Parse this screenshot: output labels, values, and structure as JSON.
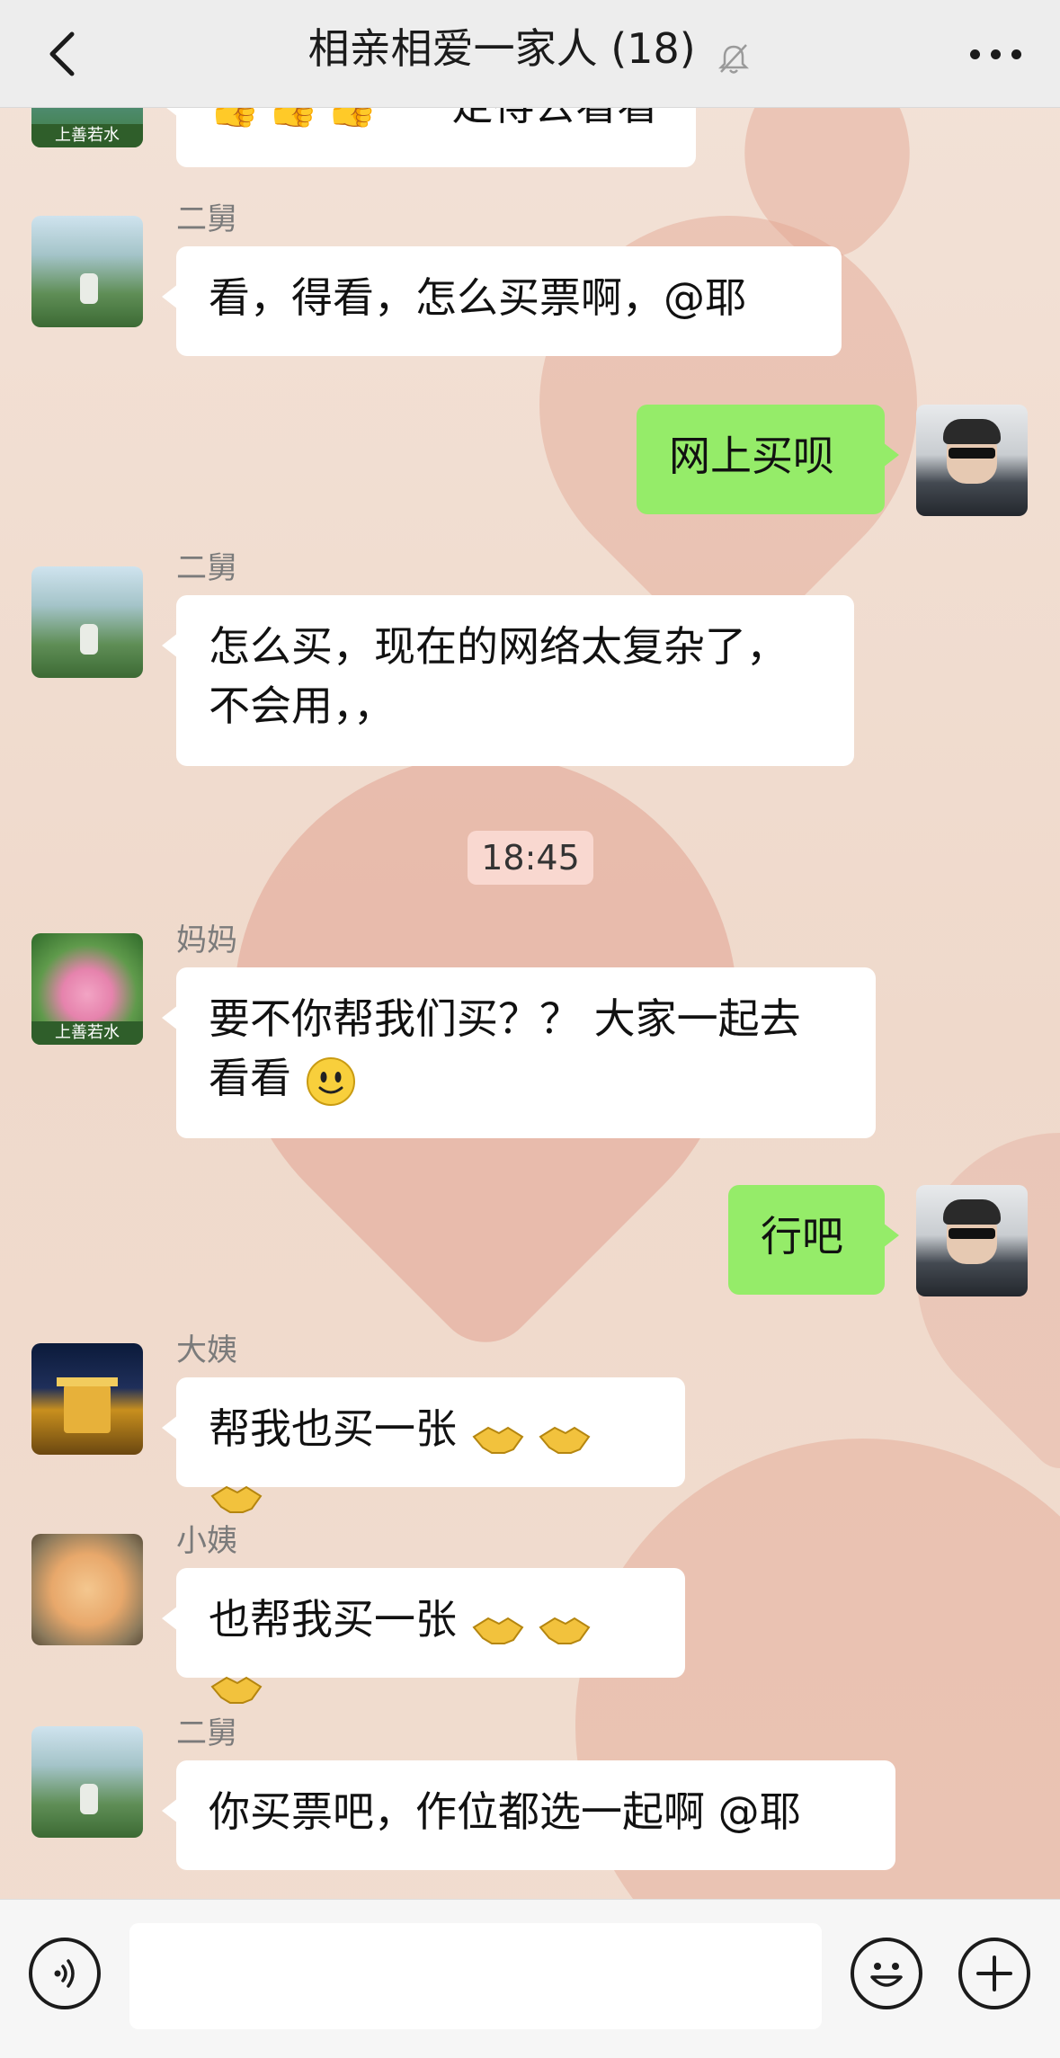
{
  "header": {
    "title": "相亲相爱一家人 (18)"
  },
  "time_separator": "18:45",
  "messages": [
    {
      "id": "m0",
      "side": "left",
      "sender": "",
      "text": "一定得去看看",
      "emoji_prefix": "👍👍👍",
      "avatar": "lotus-avatar",
      "avatar_caption": "上善若水"
    },
    {
      "id": "m1",
      "side": "left",
      "sender": "二舅",
      "text": "看，得看，怎么买票啊，@耶",
      "avatar": "mountain-avatar"
    },
    {
      "id": "m2",
      "side": "right",
      "sender": "",
      "text": "网上买呗",
      "avatar": "me-avatar"
    },
    {
      "id": "m3",
      "side": "left",
      "sender": "二舅",
      "text": "怎么买，现在的网络太复杂了，",
      "text2": "不会用，，",
      "avatar": "mountain-avatar"
    },
    {
      "id": "m4",
      "side": "left",
      "sender": "妈妈",
      "text": "要不你帮我们买？？  大家一起去",
      "text2": "看看",
      "avatar": "lotus-avatar",
      "avatar_caption": "上善若水"
    },
    {
      "id": "m5",
      "side": "right",
      "sender": "",
      "text": "行吧",
      "avatar": "me-avatar"
    },
    {
      "id": "m6",
      "side": "left",
      "sender": "大姨",
      "text": "帮我也买一张",
      "avatar": "tower-avatar"
    },
    {
      "id": "m7",
      "side": "left",
      "sender": "小姨",
      "text": "也帮我买一张",
      "avatar": "rose-avatar"
    },
    {
      "id": "m8",
      "side": "left",
      "sender": "二舅",
      "text": "你买票吧，作位都选一起啊 @耶",
      "avatar": "mountain-avatar"
    }
  ],
  "input": {
    "value": "",
    "placeholder": ""
  },
  "icons": {
    "back": "chevron-left-icon",
    "mute": "bell-off-icon",
    "more": "more-dots-icon",
    "voice": "voice-icon",
    "emoji": "emoji-icon",
    "plus": "plus-icon"
  },
  "colors": {
    "my_bubble": "#95ec69",
    "other_bubble": "#ffffff",
    "header_bg": "#ededed"
  }
}
